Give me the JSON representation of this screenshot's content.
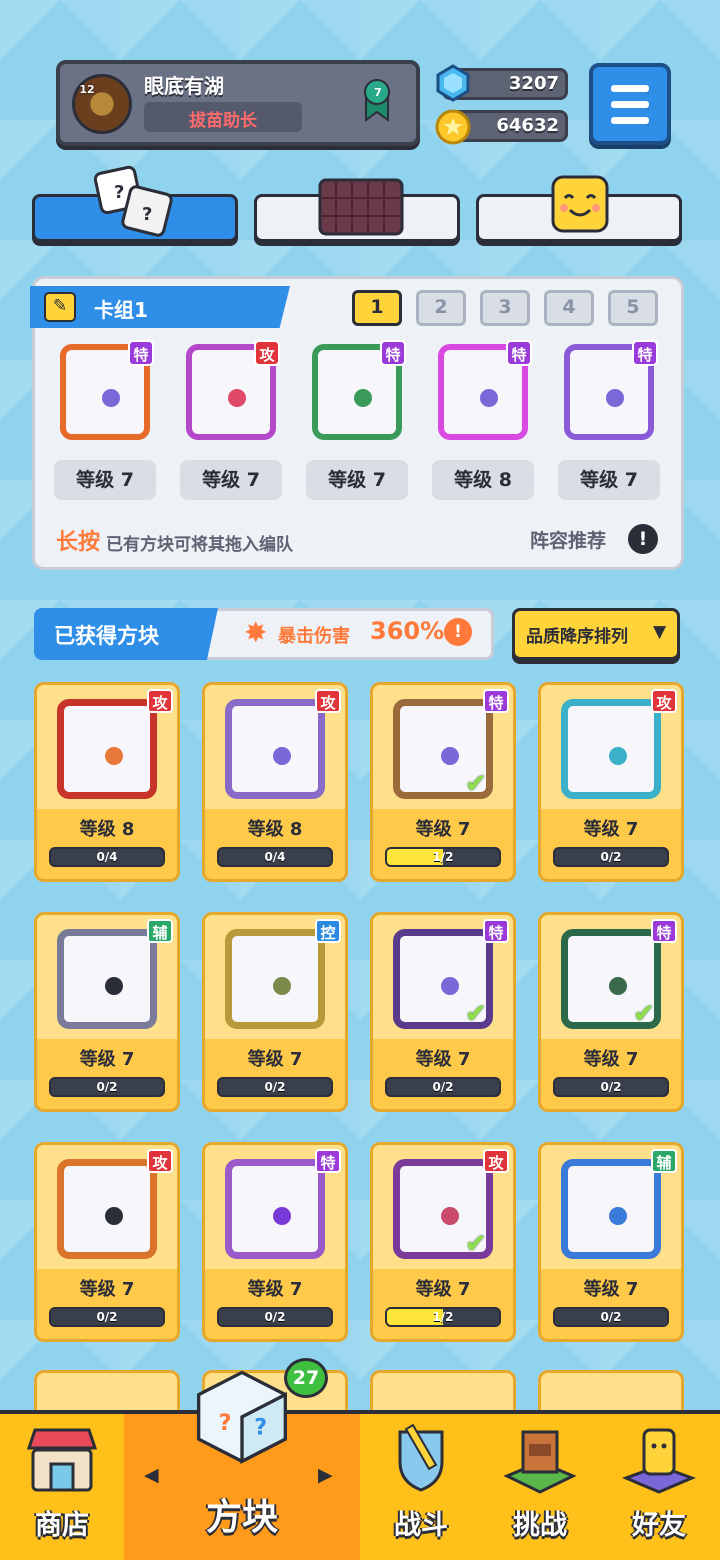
{
  "profile": {
    "name": "眼底有湖",
    "title": "拔苗助长",
    "avatar_level": "12",
    "rank": "7"
  },
  "currency": {
    "gems": "3207",
    "coins": "64632"
  },
  "deck": {
    "title": "卡组1",
    "slots": [
      "1",
      "2",
      "3",
      "4",
      "5"
    ],
    "active_slot": "1",
    "cards": [
      {
        "tag": "特",
        "level": "等级 7",
        "color": "#e86a2a",
        "dot": "#7a67d8"
      },
      {
        "tag": "攻",
        "level": "等级 7",
        "color": "#b348c9",
        "dot": "#e04a6a"
      },
      {
        "tag": "特",
        "level": "等级 7",
        "color": "#3a9a5a",
        "dot": "#3a9a5a"
      },
      {
        "tag": "特",
        "level": "等级 8",
        "color": "#d94ae0",
        "dot": "#7a67d8"
      },
      {
        "tag": "特",
        "level": "等级 7",
        "color": "#8a5ad8",
        "dot": "#7a67d8"
      }
    ],
    "hint_key": "长按",
    "hint_rest": "已有方块可将其拖入编队",
    "recommend": "阵容推荐"
  },
  "owned": {
    "label": "已获得方块",
    "crit_label": "暴击伤害",
    "crit_value": "360%",
    "sort_label": "品质降序排列"
  },
  "grid": [
    {
      "tag": "攻",
      "level": "等级 8",
      "progress": "0/4",
      "fill": 0,
      "color": "#c9342a",
      "dot": "#e8783a",
      "check": false
    },
    {
      "tag": "攻",
      "level": "等级 8",
      "progress": "0/4",
      "fill": 0,
      "color": "#8a6ac9",
      "dot": "#7a67d8",
      "check": false
    },
    {
      "tag": "特",
      "level": "等级 7",
      "progress": "1/2",
      "fill": 0.5,
      "color": "#9a6a3a",
      "dot": "#7a67d8",
      "check": true
    },
    {
      "tag": "攻",
      "level": "等级 7",
      "progress": "0/2",
      "fill": 0,
      "color": "#3ab0c9",
      "dot": "#3ab0c9",
      "check": false
    },
    {
      "tag": "辅",
      "level": "等级 7",
      "progress": "0/2",
      "fill": 0,
      "color": "#7a7a9a",
      "dot": "#2b2e38",
      "check": false
    },
    {
      "tag": "控",
      "level": "等级 7",
      "progress": "0/2",
      "fill": 0,
      "color": "#b89a3a",
      "dot": "#7a8a4a",
      "check": false
    },
    {
      "tag": "特",
      "level": "等级 7",
      "progress": "0/2",
      "fill": 0,
      "color": "#5a3a8a",
      "dot": "#7a67d8",
      "check": true
    },
    {
      "tag": "特",
      "level": "等级 7",
      "progress": "0/2",
      "fill": 0,
      "color": "#2a6a4a",
      "dot": "#3a6a4a",
      "check": true
    },
    {
      "tag": "攻",
      "level": "等级 7",
      "progress": "0/2",
      "fill": 0,
      "color": "#d9742a",
      "dot": "#2b2e38",
      "check": false
    },
    {
      "tag": "特",
      "level": "等级 7",
      "progress": "0/2",
      "fill": 0,
      "color": "#9a5ac9",
      "dot": "#7a3ad8",
      "check": false
    },
    {
      "tag": "攻",
      "level": "等级 7",
      "progress": "1/2",
      "fill": 0.5,
      "color": "#7a3a9a",
      "dot": "#c94a6a",
      "check": true
    },
    {
      "tag": "辅",
      "level": "等级 7",
      "progress": "0/2",
      "fill": 0,
      "color": "#3a7ad8",
      "dot": "#3a7ad8",
      "check": false
    }
  ],
  "tag_colors": {
    "攻": "#e0343a",
    "特": "#9a3ad8",
    "辅": "#2aa86a",
    "控": "#2a8ae0"
  },
  "bottom_nav": {
    "badge": "27",
    "items": [
      "商店",
      "方块",
      "战斗",
      "挑战",
      "好友"
    ]
  }
}
